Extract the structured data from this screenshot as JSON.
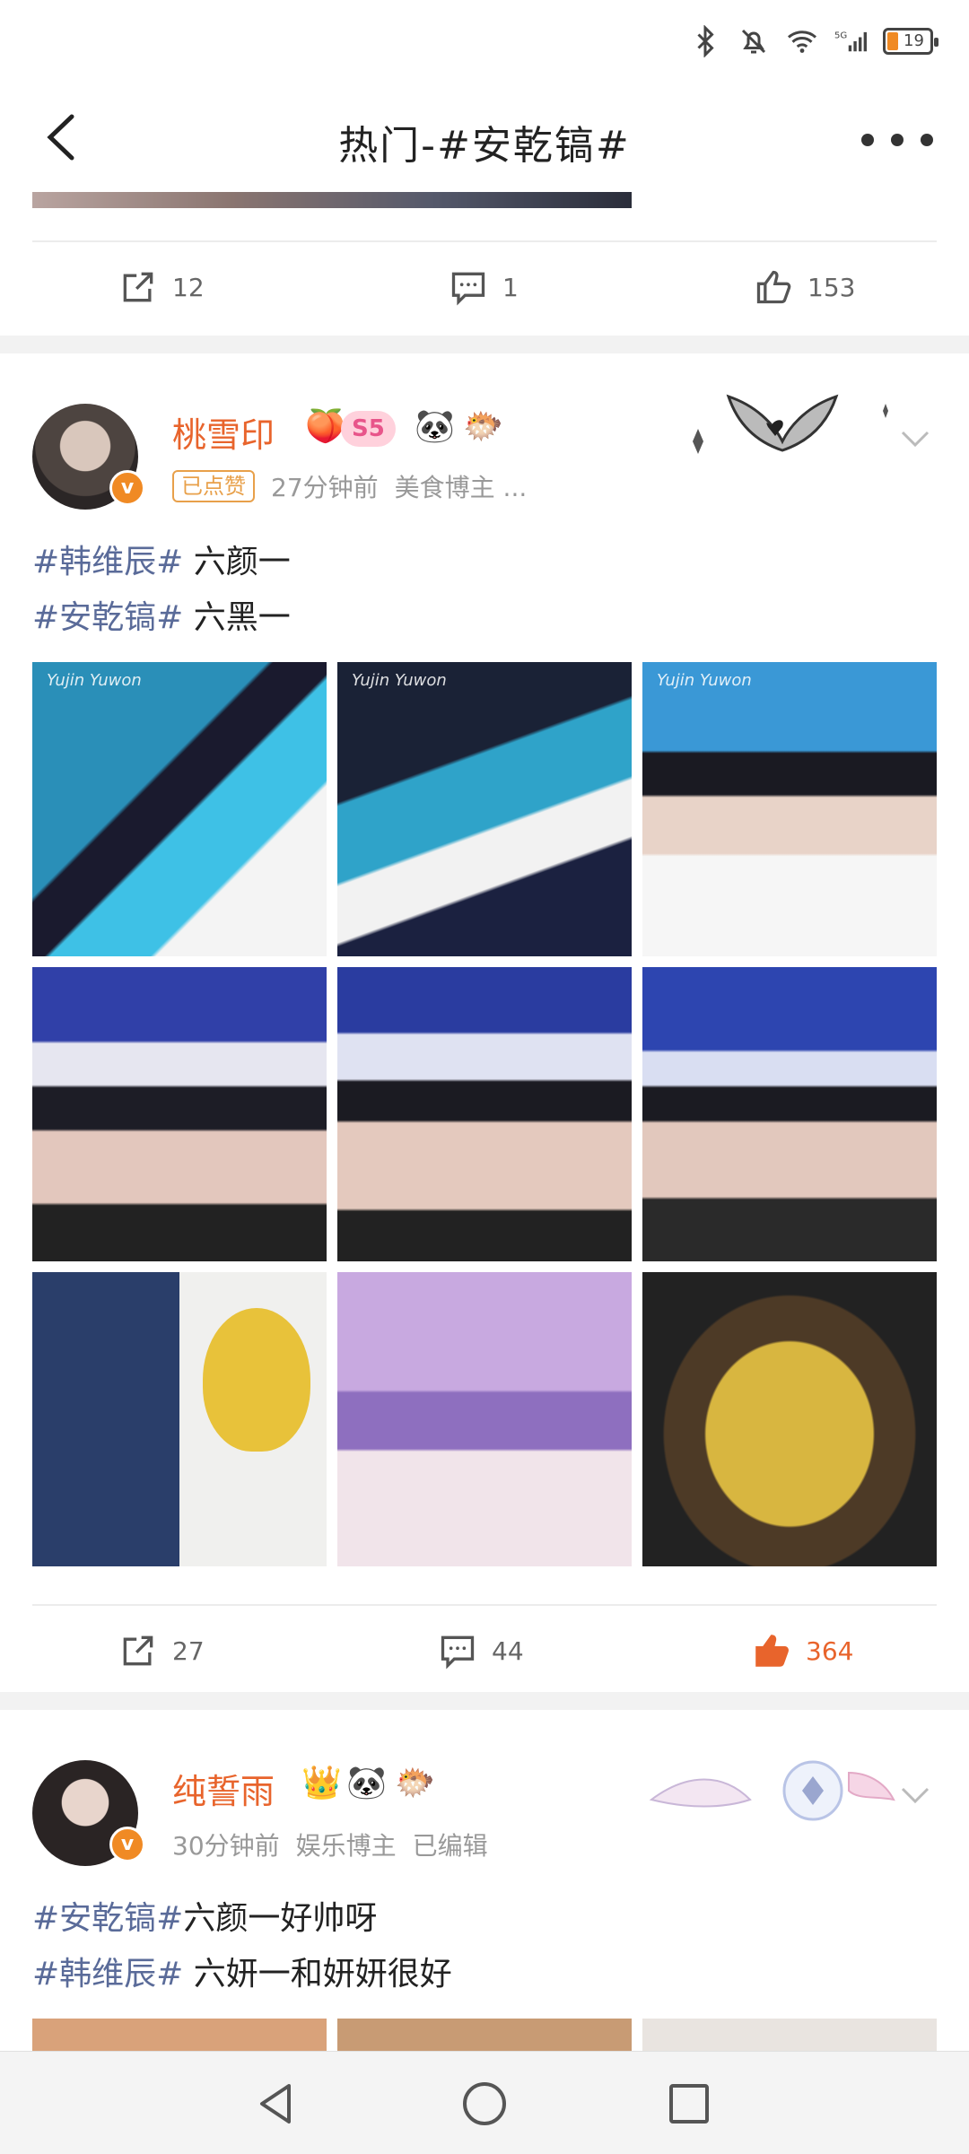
{
  "status": {
    "battery": "19"
  },
  "nav": {
    "title": "热门-#安乾镐#"
  },
  "post1": {
    "repost_count": "12",
    "comment_count": "1",
    "like_count": "153"
  },
  "post2": {
    "username": "桃雪印",
    "level": "S5",
    "badge": "已点赞",
    "time": "27分钟前",
    "source": "美食博主 ...",
    "line1_tag": "#韩维辰#",
    "line1_text": " 六颜一",
    "line2_tag": "#安乾镐#",
    "line2_text": " 六黑一",
    "watermark": "Yujin Yuwon",
    "repost_count": "27",
    "comment_count": "44",
    "like_count": "364"
  },
  "post3": {
    "username": "纯誓雨",
    "time": "30分钟前",
    "source": "娱乐博主",
    "edited": "已编辑",
    "line1_tag": "#安乾镐#",
    "line1_text": "六颜一好帅呀",
    "line2_tag": "#韩维辰#",
    "line2_text": " 六妍一和妍妍很好"
  },
  "colors": {
    "accent": "#e8642c",
    "hashtag": "#5a6b99",
    "level_bg": "#ffd1dc"
  }
}
